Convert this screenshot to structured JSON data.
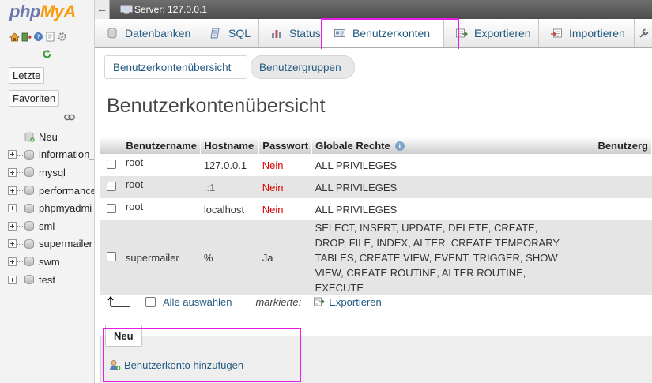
{
  "nav": {
    "logo_php": "php",
    "logo_my": "MyA",
    "recent_label": "Letzte",
    "favorites_label": "Favoriten",
    "tree": [
      {
        "label": "Neu",
        "kind": "new"
      },
      {
        "label": "information_",
        "kind": "db"
      },
      {
        "label": "mysql",
        "kind": "db"
      },
      {
        "label": "performance",
        "kind": "db"
      },
      {
        "label": "phpmyadmi",
        "kind": "db"
      },
      {
        "label": "sml",
        "kind": "db"
      },
      {
        "label": "supermailer",
        "kind": "db"
      },
      {
        "label": "swm",
        "kind": "db"
      },
      {
        "label": "test",
        "kind": "db"
      }
    ]
  },
  "serverbar": {
    "collapse_glyph": "←",
    "server_label": "Server: 127.0.0.1"
  },
  "tabs": [
    {
      "label": "Datenbanken",
      "icon": "database-icon"
    },
    {
      "label": "SQL",
      "icon": "sql-icon"
    },
    {
      "label": "Status",
      "icon": "status-icon"
    },
    {
      "label": "Benutzerkonten",
      "icon": "user-accounts-icon",
      "active": true
    },
    {
      "label": "Exportieren",
      "icon": "export-icon"
    },
    {
      "label": "Importieren",
      "icon": "import-icon"
    }
  ],
  "subtabs": {
    "overview": "Benutzerkontenübersicht",
    "groups": "Benutzergruppen"
  },
  "page_title": "Benutzerkontenübersicht",
  "table": {
    "headers": [
      "Benutzername",
      "Hostname",
      "Passwort",
      "Globale Rechte",
      "Benutzerg"
    ],
    "rows": [
      {
        "user": "root",
        "host": "127.0.0.1",
        "password": "Nein",
        "privileges": "ALL PRIVILEGES"
      },
      {
        "user": "root",
        "host": "::1",
        "password": "Nein",
        "privileges": "ALL PRIVILEGES"
      },
      {
        "user": "root",
        "host": "localhost",
        "password": "Nein",
        "privileges": "ALL PRIVILEGES"
      },
      {
        "user": "supermailer",
        "host": "%",
        "password": "Ja",
        "privileges": "SELECT, INSERT, UPDATE, DELETE, CREATE, DROP, FILE, INDEX, ALTER, CREATE TEMPORARY TABLES, CREATE VIEW, EVENT, TRIGGER, SHOW VIEW, CREATE ROUTINE, ALTER ROUTINE, EXECUTE"
      }
    ]
  },
  "bulk": {
    "select_all_label": "Alle auswählen",
    "marked_label": "markierte:",
    "export_label": "Exportieren"
  },
  "new_section": {
    "legend": "Neu",
    "add_user_label": "Benutzerkonto hinzufügen"
  },
  "colors": {
    "highlight": "#e51de5",
    "link": "#235a81",
    "password_no": "#e00000"
  }
}
